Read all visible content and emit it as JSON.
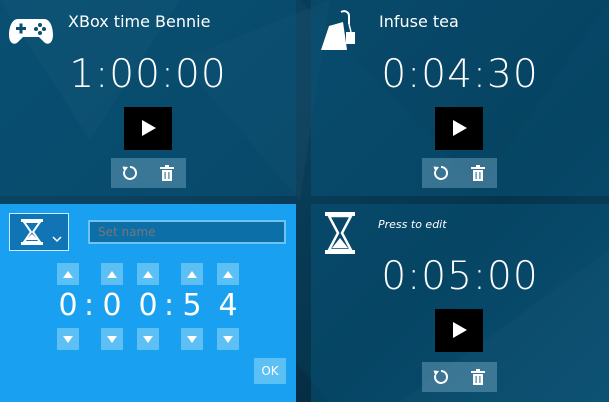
{
  "timers": [
    {
      "name": "XBox time Bennie",
      "time": "1:00:00",
      "icon": "gamepad-icon"
    },
    {
      "name": "Infuse tea",
      "time": "0:04:30",
      "icon": "teabag-icon"
    },
    {
      "hint": "Press to edit",
      "time": "0:05:00",
      "icon": "hourglass-icon"
    }
  ],
  "editor": {
    "name_placeholder": "Set name",
    "icon": "hourglass-icon",
    "digits": [
      "0",
      "0",
      "0",
      "5",
      "4"
    ],
    "separators": [
      ":",
      ":"
    ],
    "ok_label": "OK"
  },
  "colors": {
    "background": "#0a3f5c",
    "editor_tile": "#1aa0f0",
    "play_button": "#000000",
    "arrow_button": "#5dc0f5"
  }
}
